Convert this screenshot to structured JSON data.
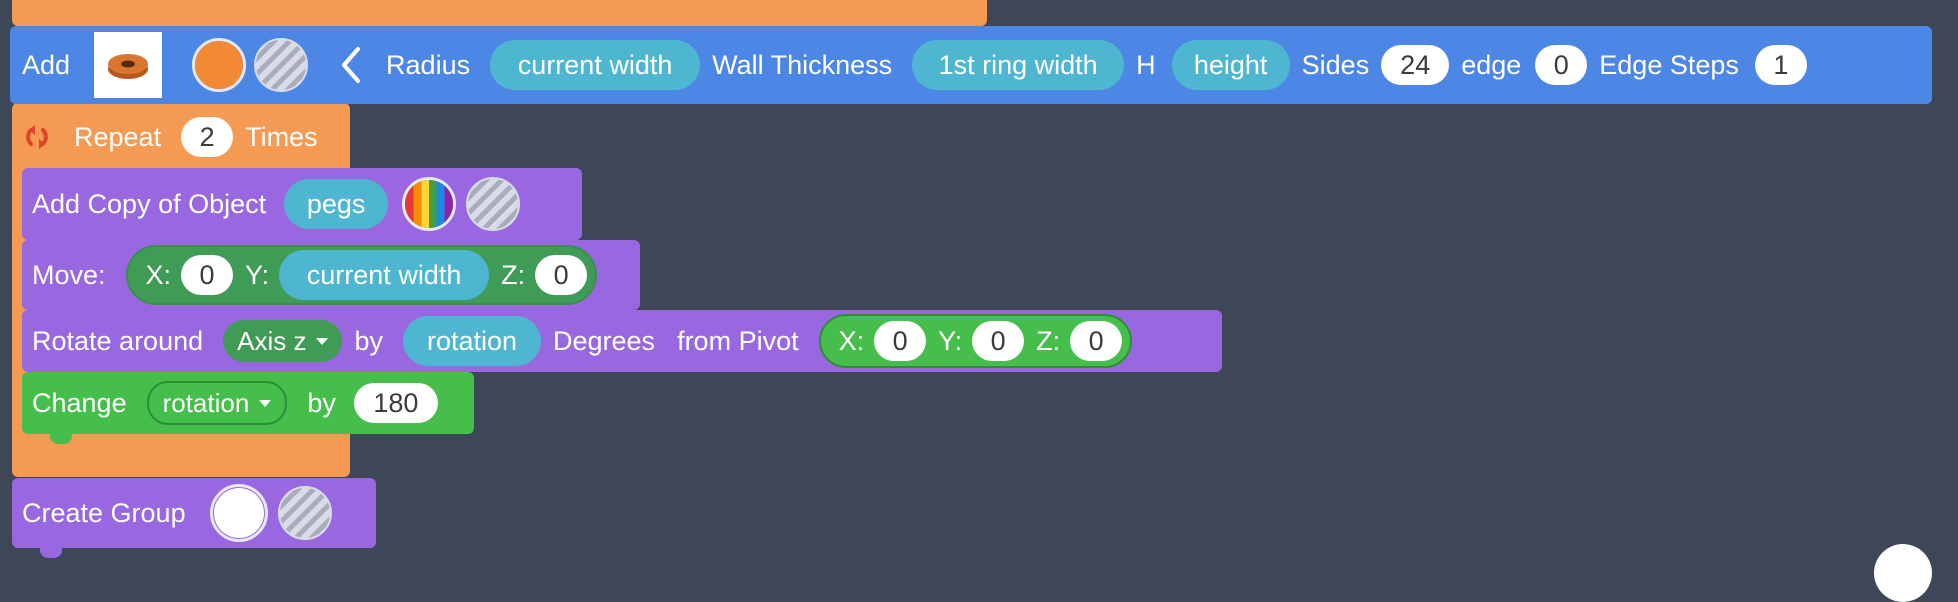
{
  "colors": {
    "orange": "#f59a52",
    "blue": "#4d87e6",
    "purple": "#9968e0",
    "green": "#45be4c",
    "dark_green": "#3f9b55",
    "pill": "#4fb6d2",
    "canvas": "#3d4757"
  },
  "add_block": {
    "add_label": "Add",
    "back_icon": "chevron-left-icon",
    "radius_label": "Radius",
    "radius_value": "current width",
    "wall_label": "Wall Thickness",
    "wall_value": "1st ring width",
    "h_label": "H",
    "h_value": "height",
    "sides_label": "Sides",
    "sides_value": "24",
    "edge_label": "edge",
    "edge_value": "0",
    "edge_steps_label": "Edge Steps",
    "edge_steps_value": "1",
    "color": "#f28a35"
  },
  "repeat_block": {
    "icon": "repeat-icon",
    "label": "Repeat",
    "count": "2",
    "times_label": "Times"
  },
  "copy_block": {
    "label": "Add Copy of Object",
    "object_value": "pegs"
  },
  "move_block": {
    "label": "Move:",
    "x_label": "X:",
    "x_value": "0",
    "y_label": "Y:",
    "y_value": "current width",
    "z_label": "Z:",
    "z_value": "0"
  },
  "rotate_block": {
    "label": "Rotate around",
    "axis_value": "Axis z",
    "by_label": "by",
    "amount_value": "rotation",
    "degrees_label": "Degrees",
    "pivot_label": "from Pivot",
    "x_label": "X:",
    "x_value": "0",
    "y_label": "Y:",
    "y_value": "0",
    "z_label": "Z:",
    "z_value": "0"
  },
  "change_block": {
    "label": "Change",
    "variable_value": "rotation",
    "by_label": "by",
    "amount_value": "180"
  },
  "group_block": {
    "label": "Create Group",
    "color": "#ffffff"
  }
}
